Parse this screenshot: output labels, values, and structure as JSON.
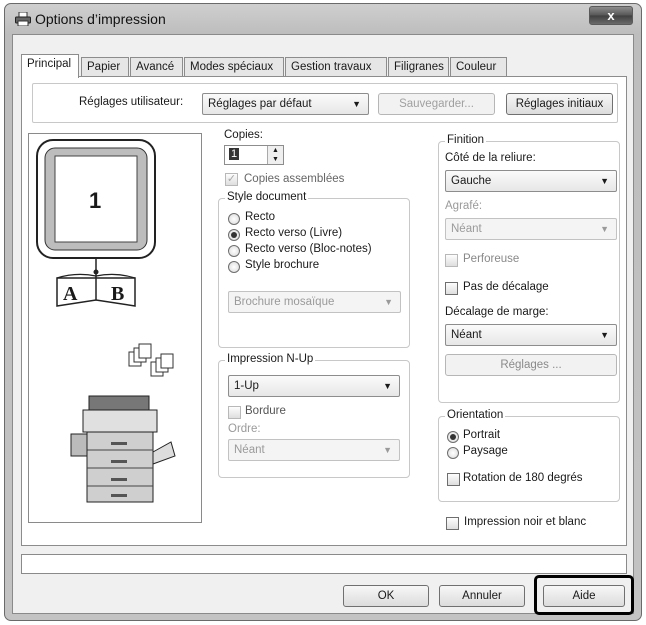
{
  "window": {
    "title": "Options d’impression",
    "close_label": "x"
  },
  "tabs": [
    {
      "label": "Principal"
    },
    {
      "label": "Papier"
    },
    {
      "label": "Avancé"
    },
    {
      "label": "Modes spéciaux"
    },
    {
      "label": "Gestion travaux"
    },
    {
      "label": "Filigranes"
    },
    {
      "label": "Couleur"
    }
  ],
  "user_settings": {
    "label": "Réglages utilisateur:",
    "value": "Réglages par défaut",
    "save_label": "Sauvegarder...",
    "reset_label": "Réglages initiaux"
  },
  "preview": {
    "page_number": "1",
    "book_left": "A",
    "book_right": "B"
  },
  "copies": {
    "label": "Copies:",
    "value": "1",
    "collate_label": "Copies assemblées",
    "collate_checked": true
  },
  "document_style": {
    "legend": "Style document",
    "options": [
      "Recto",
      "Recto verso (Livre)",
      "Recto verso (Bloc-notes)",
      "Style brochure"
    ],
    "selected": "Recto verso (Livre)",
    "brochure_value": "Brochure mosaïque"
  },
  "nup": {
    "legend": "Impression N-Up",
    "value": "1-Up",
    "border_label": "Bordure",
    "order_label": "Ordre:",
    "order_value": "Néant"
  },
  "finishing": {
    "legend": "Finition",
    "binding_label": "Côté de la reliure:",
    "binding_value": "Gauche",
    "staple_label": "Agrafé:",
    "staple_value": "Néant",
    "punch_label": "Perforeuse",
    "no_offset_label": "Pas de décalage",
    "margin_shift_label": "Décalage de marge:",
    "margin_shift_value": "Néant",
    "settings_label": "Réglages ..."
  },
  "orientation": {
    "legend": "Orientation",
    "options": [
      "Portrait",
      "Paysage"
    ],
    "selected": "Portrait",
    "rotate_label": "Rotation de 180 degrés"
  },
  "bw_label": "Impression noir et blanc",
  "footer": {
    "ok_label": "OK",
    "cancel_label": "Annuler",
    "help_label": "Aide"
  },
  "colors": {
    "frame": "#c3c3c3",
    "client": "#f0f0f0",
    "panel": "#ffffff",
    "highlight": "#000000"
  }
}
